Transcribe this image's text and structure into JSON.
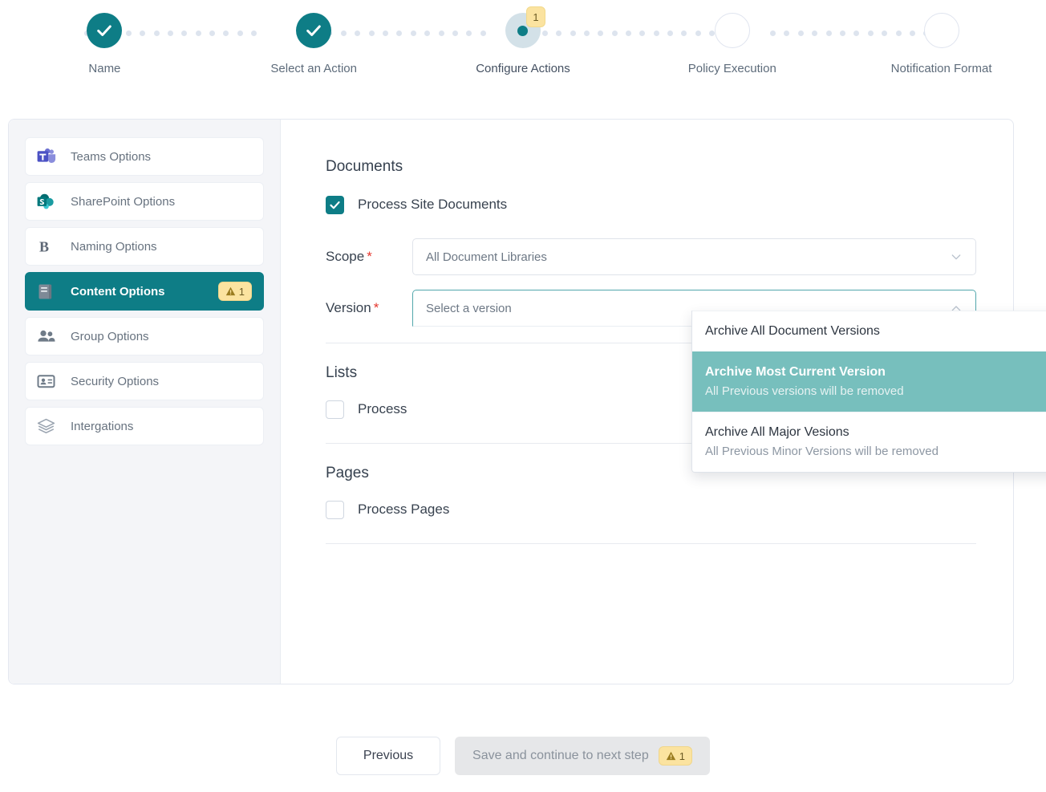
{
  "stepper": {
    "steps": [
      {
        "label": "Name",
        "state": "done"
      },
      {
        "label": "Select an Action",
        "state": "done"
      },
      {
        "label": "Configure Actions",
        "state": "current",
        "badge": "1"
      },
      {
        "label": "Policy Execution",
        "state": "pending"
      },
      {
        "label": "Notification Format",
        "state": "pending"
      }
    ]
  },
  "sidebar": {
    "items": [
      {
        "label": "Teams Options",
        "icon": "teams-icon",
        "active": false,
        "badge": null
      },
      {
        "label": "SharePoint Options",
        "icon": "sharepoint-icon",
        "active": false,
        "badge": null
      },
      {
        "label": "Naming Options",
        "icon": "bold-b-icon",
        "active": false,
        "badge": null
      },
      {
        "label": "Content Options",
        "icon": "book-icon",
        "active": true,
        "badge": "1"
      },
      {
        "label": "Group Options",
        "icon": "people-icon",
        "active": false,
        "badge": null
      },
      {
        "label": "Security Options",
        "icon": "id-card-icon",
        "active": false,
        "badge": null
      },
      {
        "label": "Intergations",
        "icon": "layers-icon",
        "active": false,
        "badge": null
      }
    ]
  },
  "main": {
    "documents": {
      "title": "Documents",
      "process_checkbox_label": "Process Site Documents",
      "process_checked": true,
      "scope": {
        "label": "Scope",
        "required": true,
        "value": "All Document Libraries"
      },
      "version": {
        "label": "Version",
        "required": true,
        "placeholder": "Select a version",
        "value": "",
        "open": true,
        "options": [
          {
            "title": "Archive All Document Versions",
            "subtitle": "",
            "selected": false
          },
          {
            "title": "Archive Most Current Version",
            "subtitle": "All Previous versions will be removed",
            "selected": true
          },
          {
            "title": "Archive All Major Vesions",
            "subtitle": "All Previous Minor Versions will be removed",
            "selected": false
          }
        ]
      }
    },
    "lists": {
      "title": "Lists",
      "process_checkbox_label": "Process",
      "process_checked": false
    },
    "pages": {
      "title": "Pages",
      "process_checkbox_label": "Process Pages",
      "process_checked": false
    }
  },
  "footer": {
    "previous_label": "Previous",
    "save_label": "Save and continue to next step",
    "save_badge": "1"
  },
  "colors": {
    "teal": "#0e7d86",
    "highlight": "#77bfbd",
    "badge_yellow": "#fbe3a0",
    "required_red": "#e5372e",
    "sidebar_bg": "#f4f5f8"
  }
}
